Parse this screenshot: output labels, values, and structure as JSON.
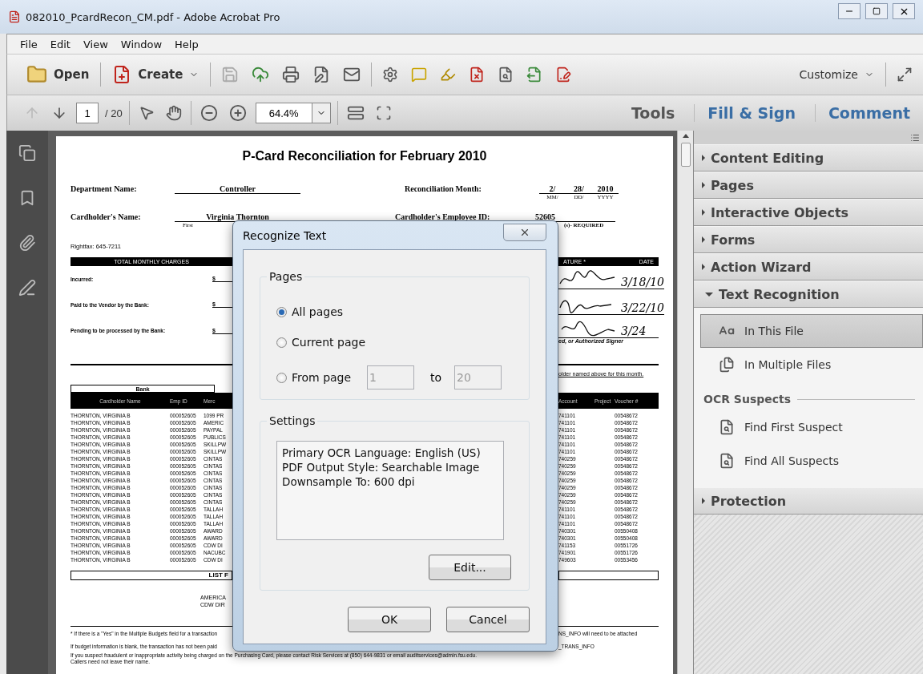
{
  "window": {
    "title": "082010_PcardRecon_CM.pdf - Adobe Acrobat Pro"
  },
  "menu": [
    "File",
    "Edit",
    "View",
    "Window",
    "Help"
  ],
  "toolbar": {
    "open": "Open",
    "create": "Create",
    "customize": "Customize"
  },
  "nav": {
    "page": "1",
    "total": "/ 20",
    "zoom": "64.4%",
    "tabs": [
      {
        "label": "Tools",
        "selected": true
      },
      {
        "label": "Fill & Sign",
        "selected": false
      },
      {
        "label": "Comment",
        "selected": false
      }
    ]
  },
  "document": {
    "title": "P-Card Reconciliation for February 2010",
    "department": {
      "label": "Department Name:",
      "value": "Controller"
    },
    "month": {
      "label": "Reconciliation Month:",
      "parts": [
        {
          "value": "2/",
          "caption": "MM/"
        },
        {
          "value": "28/",
          "caption": "DD/"
        },
        {
          "value": "2010",
          "caption": "YYYY"
        }
      ]
    },
    "cardholder": {
      "label": "Cardholder's Name:",
      "value": "Virginia Thornton",
      "caption": "First"
    },
    "employee": {
      "label": "Cardholder's Employee ID:",
      "value": "52605",
      "caption": "(s)- REQUIRED"
    },
    "rightfax": "Rightfax: 645-7211",
    "charges_header": "TOTAL MONTHLY CHARGES",
    "signature_header": "ATURE *",
    "date_header": "DATE",
    "charges": [
      {
        "label": "Incurred:",
        "currency": "$",
        "date": "3/18/10"
      },
      {
        "label": "Paid to the Vendor by the Bank:",
        "currency": "$",
        "date": "3/22/10"
      },
      {
        "label": "Pending to be processed by the Bank:",
        "currency": "$",
        "date": "3/24"
      }
    ],
    "signer_note": "ed, or Authorized Signer",
    "holder_note": "older named above for this month.",
    "table": {
      "group": "Bank",
      "columns_left": [
        "Cardholder Name",
        "Emp ID",
        "Merc"
      ],
      "columns_right": [
        "Account",
        "Project",
        "Voucher #"
      ],
      "rows": [
        {
          "name": "THORNTON, VIRGINIA B",
          "emp": "000052605",
          "merchant": "1099 PR",
          "account": "741101",
          "voucher": "00548672"
        },
        {
          "name": "THORNTON, VIRGINIA B",
          "emp": "000052605",
          "merchant": "AMERIC",
          "account": "741101",
          "voucher": "00548672"
        },
        {
          "name": "THORNTON, VIRGINIA B",
          "emp": "000052605",
          "merchant": "PAYPAL",
          "account": "741101",
          "voucher": "00548672"
        },
        {
          "name": "THORNTON, VIRGINIA B",
          "emp": "000052605",
          "merchant": "PUBLICS",
          "account": "741101",
          "voucher": "00548672"
        },
        {
          "name": "THORNTON, VIRGINIA B",
          "emp": "000052605",
          "merchant": "SKILLPW",
          "account": "741101",
          "voucher": "00548672"
        },
        {
          "name": "THORNTON, VIRGINIA B",
          "emp": "000052605",
          "merchant": "SKILLPW",
          "account": "741101",
          "voucher": "00548672"
        },
        {
          "name": "THORNTON, VIRGINIA B",
          "emp": "000052605",
          "merchant": "CINTAS",
          "account": "740259",
          "voucher": "00548672"
        },
        {
          "name": "THORNTON, VIRGINIA B",
          "emp": "000052605",
          "merchant": "CINTAS",
          "account": "740259",
          "voucher": "00548672"
        },
        {
          "name": "THORNTON, VIRGINIA B",
          "emp": "000052605",
          "merchant": "CINTAS",
          "account": "740259",
          "voucher": "00548672"
        },
        {
          "name": "THORNTON, VIRGINIA B",
          "emp": "000052605",
          "merchant": "CINTAS",
          "account": "740259",
          "voucher": "00548672"
        },
        {
          "name": "THORNTON, VIRGINIA B",
          "emp": "000052605",
          "merchant": "CINTAS",
          "account": "740259",
          "voucher": "00548672"
        },
        {
          "name": "THORNTON, VIRGINIA B",
          "emp": "000052605",
          "merchant": "CINTAS",
          "account": "740259",
          "voucher": "00548672"
        },
        {
          "name": "THORNTON, VIRGINIA B",
          "emp": "000052605",
          "merchant": "CINTAS",
          "account": "740259",
          "voucher": "00548672"
        },
        {
          "name": "THORNTON, VIRGINIA B",
          "emp": "000052605",
          "merchant": "TALLAH",
          "account": "741101",
          "voucher": "00548672"
        },
        {
          "name": "THORNTON, VIRGINIA B",
          "emp": "000052605",
          "merchant": "TALLAH",
          "account": "741101",
          "voucher": "00548672"
        },
        {
          "name": "THORNTON, VIRGINIA B",
          "emp": "000052605",
          "merchant": "TALLAH",
          "account": "741101",
          "voucher": "00548672"
        },
        {
          "name": "THORNTON, VIRGINIA B",
          "emp": "000052605",
          "merchant": "AWARD",
          "account": "740301",
          "voucher": "00550408"
        },
        {
          "name": "THORNTON, VIRGINIA B",
          "emp": "000052605",
          "merchant": "AWARD",
          "account": "740301",
          "voucher": "00550408"
        },
        {
          "name": "THORNTON, VIRGINIA B",
          "emp": "000052605",
          "merchant": "CDW DI",
          "account": "741153",
          "voucher": "00551726"
        },
        {
          "name": "THORNTON, VIRGINIA B",
          "emp": "000052605",
          "merchant": "NACUBC",
          "account": "741901",
          "voucher": "00551726"
        },
        {
          "name": "THORNTON, VIRGINIA B",
          "emp": "000052605",
          "merchant": "CDW DI",
          "account": "749603",
          "voucher": "00553456"
        }
      ]
    },
    "list_header": "LIST F",
    "list_items": [
      "AMERICA",
      "CDW DIR"
    ],
    "notes": [
      {
        "left": "* If there is a \"Yes\" in the Multiple Budgets field for a transaction",
        "right": "NS_INFO will need to be attached"
      },
      {
        "left": "If budget information is blank, the transaction has not been paid",
        "right": "_TRANS_INFO"
      }
    ],
    "footer": [
      "If you suspect fraudulent or inappropriate activity being charged on the Purchasing Card, please contact Risk Services at (850) 644-9831 or email auditservices@admin.fsu.edu.",
      "Callers need not leave their name."
    ]
  },
  "panel": {
    "sections": [
      {
        "label": "Content Editing",
        "expanded": false
      },
      {
        "label": "Pages",
        "expanded": false
      },
      {
        "label": "Interactive Objects",
        "expanded": false
      },
      {
        "label": "Forms",
        "expanded": false
      },
      {
        "label": "Action Wizard",
        "expanded": false
      },
      {
        "label": "Text Recognition",
        "expanded": true,
        "items": [
          {
            "kind": "action",
            "label": "In This File",
            "selected": true
          },
          {
            "kind": "action",
            "label": "In Multiple Files",
            "selected": false
          },
          {
            "kind": "heading",
            "label": "OCR Suspects"
          },
          {
            "kind": "action",
            "label": "Find First Suspect",
            "selected": false
          },
          {
            "kind": "action",
            "label": "Find All Suspects",
            "selected": false
          }
        ]
      },
      {
        "label": "Protection",
        "expanded": false
      }
    ]
  },
  "dialog": {
    "title": "Recognize Text",
    "pages_label": "Pages",
    "options": [
      {
        "label": "All pages",
        "selected": true
      },
      {
        "label": "Current page",
        "selected": false
      },
      {
        "label": "From page",
        "selected": false
      }
    ],
    "from": {
      "value": "1",
      "disabled": true
    },
    "to_label": "to",
    "to": {
      "value": "20",
      "disabled": true
    },
    "settings_label": "Settings",
    "settings": [
      "Primary OCR Language: English (US)",
      "PDF Output Style: Searchable Image",
      "Downsample To: 600 dpi"
    ],
    "edit": "Edit...",
    "ok": "OK",
    "cancel": "Cancel"
  }
}
